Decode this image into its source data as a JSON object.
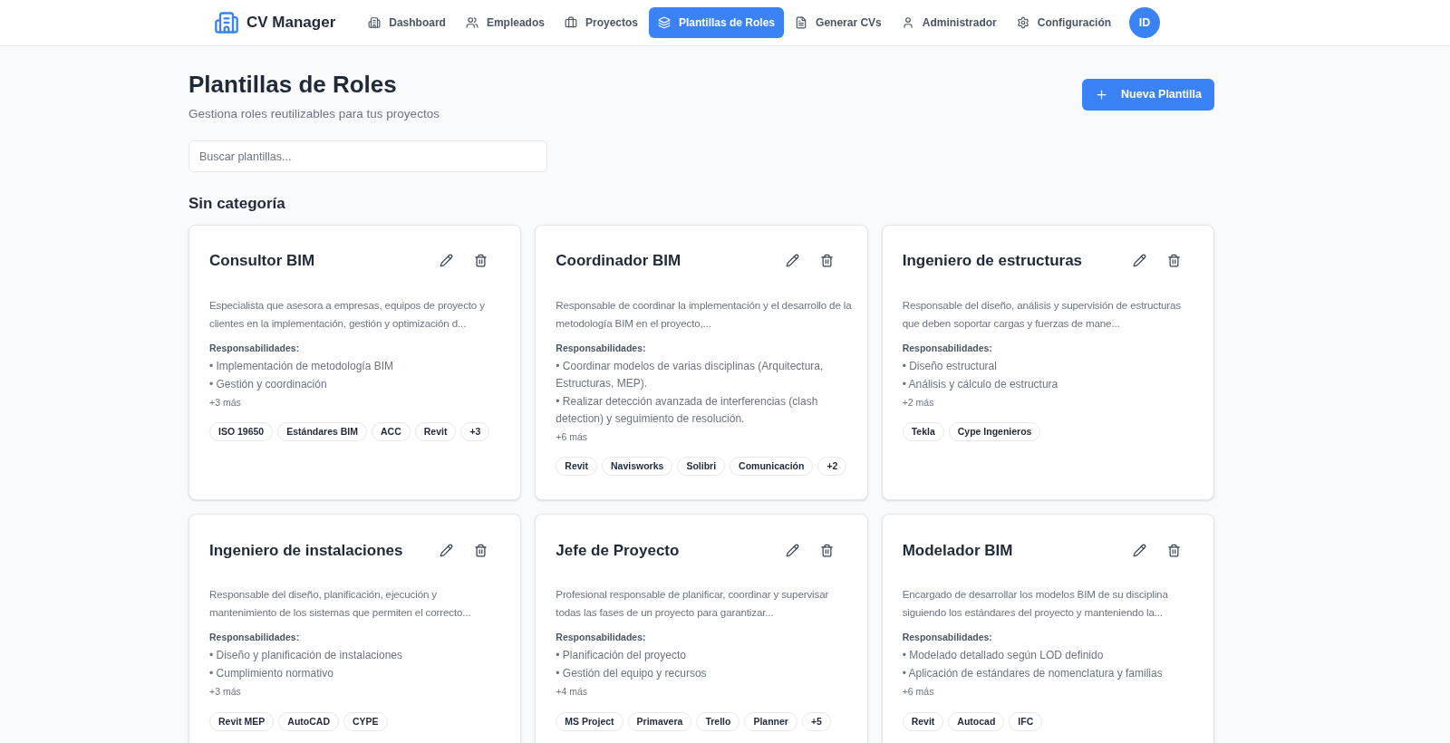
{
  "brand": {
    "title": "CV Manager"
  },
  "nav": [
    {
      "label": "Dashboard",
      "selected": false
    },
    {
      "label": "Empleados",
      "selected": false
    },
    {
      "label": "Proyectos",
      "selected": false
    },
    {
      "label": "Plantillas de Roles",
      "selected": true
    },
    {
      "label": "Generar CVs",
      "selected": false
    },
    {
      "label": "Administrador",
      "selected": false
    },
    {
      "label": "Configuración",
      "selected": false
    }
  ],
  "avatar": "ID",
  "header": {
    "title": "Plantillas de Roles",
    "subtitle": "Gestiona roles reutilizables para tus proyectos",
    "new_button": "Nueva Plantilla"
  },
  "search": {
    "placeholder": "Buscar plantillas..."
  },
  "section_title": "Sin categoría",
  "templates": [
    {
      "title": "Consultor BIM",
      "description": "Especialista que asesora a empresas, equipos de proyecto y clientes en la implementación, gestión y optimización d...",
      "responsibilities_label": "Responsabilidades:",
      "responsibilities": [
        "• Implementación de metodología BIM",
        "• Gestión y coordinación"
      ],
      "more": "+3 más",
      "tags": [
        "ISO 19650",
        "Estándares BIM",
        "ACC",
        "Revit",
        "+3"
      ]
    },
    {
      "title": "Coordinador BIM",
      "description": "Responsable de coordinar la implementación y el desarrollo de la metodología BIM en el proyecto,...",
      "responsibilities_label": "Responsabilidades:",
      "responsibilities": [
        "• Coordinar modelos de varias disciplinas (Arquitectura, Estructuras, MEP).",
        "• Realizar detección avanzada de interferencias (clash detection) y seguimiento de resolución."
      ],
      "more": "+6 más",
      "tags": [
        "Revit",
        "Navisworks",
        "Solibri",
        "Comunicación",
        "+2"
      ]
    },
    {
      "title": "Ingeniero de estructuras",
      "description": "Responsable del diseño, análisis y supervisión de estructuras que deben soportar cargas y fuerzas de mane...",
      "responsibilities_label": "Responsabilidades:",
      "responsibilities": [
        "• Diseño estructural",
        "• Análisis y cálculo de estructura"
      ],
      "more": "+2 más",
      "tags": [
        "Tekla",
        "Cype Ingenieros"
      ]
    },
    {
      "title": "Ingeniero de instalaciones",
      "description": "Responsable del diseño, planificación, ejecución y mantenimiento de los sistemas que permiten el correcto...",
      "responsibilities_label": "Responsabilidades:",
      "responsibilities": [
        "• Diseño y planificación de instalaciones",
        "• Cumplimiento normativo"
      ],
      "more": "+3 más",
      "tags": [
        "Revit MEP",
        "AutoCAD",
        "CYPE"
      ]
    },
    {
      "title": "Jefe de Proyecto",
      "description": "Profesional responsable de planificar, coordinar y supervisar todas las fases de un proyecto para garantizar...",
      "responsibilities_label": "Responsabilidades:",
      "responsibilities": [
        "• Planificación del proyecto",
        "• Gestión del equipo y recursos"
      ],
      "more": "+4 más",
      "tags": [
        "MS Project",
        "Primavera",
        "Trello",
        "Planner",
        "+5"
      ]
    },
    {
      "title": "Modelador BIM",
      "description": "Encargado de desarrollar los modelos BIM de su disciplina siguiendo los estándares del proyecto y manteniendo la...",
      "responsibilities_label": "Responsabilidades:",
      "responsibilities": [
        "• Modelado detallado según LOD definido",
        "• Aplicación de estándares de nomenclatura y familias"
      ],
      "more": "+6 más",
      "tags": [
        "Revit",
        "Autocad",
        "IFC"
      ]
    }
  ]
}
